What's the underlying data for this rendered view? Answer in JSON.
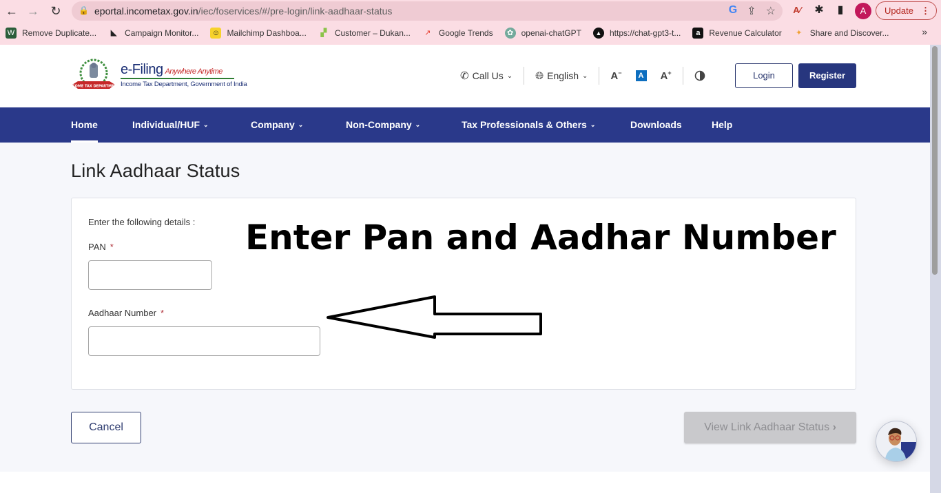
{
  "browser": {
    "url_host": "eportal.incometax.gov.in",
    "url_path": "/iec/foservices/#/pre-login/link-aadhaar-status",
    "profile_initial": "A",
    "update_label": "Update",
    "bookmarks": [
      {
        "label": "Remove Duplicate...",
        "icon": "remove-duplicate-icon"
      },
      {
        "label": "Campaign Monitor...",
        "icon": "campaign-monitor-icon"
      },
      {
        "label": "Mailchimp Dashboa...",
        "icon": "mailchimp-icon"
      },
      {
        "label": "Customer – Dukan...",
        "icon": "dukan-icon"
      },
      {
        "label": "Google Trends",
        "icon": "google-trends-icon"
      },
      {
        "label": "openai-chatGPT",
        "icon": "openai-icon"
      },
      {
        "label": "https://chat-gpt3-t...",
        "icon": "chat-gpt3-icon"
      },
      {
        "label": "Revenue Calculator",
        "icon": "amazon-icon"
      },
      {
        "label": "Share and Discover...",
        "icon": "share-discover-icon"
      }
    ],
    "more_bookmarks": "»"
  },
  "header": {
    "logo_title": "e-Filing",
    "logo_tagline": "Anywhere Anytime",
    "logo_subtitle": "Income Tax Department, Government of India",
    "call_us": "Call Us",
    "language": "English",
    "font_decrease": "A",
    "font_normal": "A",
    "font_increase": "A",
    "login_label": "Login",
    "register_label": "Register"
  },
  "nav": {
    "items": [
      {
        "label": "Home",
        "active": true,
        "dropdown": false
      },
      {
        "label": "Individual/HUF",
        "dropdown": true
      },
      {
        "label": "Company",
        "dropdown": true
      },
      {
        "label": "Non-Company",
        "dropdown": true
      },
      {
        "label": "Tax Professionals & Others",
        "dropdown": true
      },
      {
        "label": "Downloads",
        "dropdown": false
      },
      {
        "label": "Help",
        "dropdown": false
      }
    ]
  },
  "main": {
    "page_title": "Link Aadhaar Status",
    "form_intro": "Enter the following details :",
    "pan_label": "PAN",
    "pan_value": "",
    "aadhaar_label": "Aadhaar Number",
    "aadhaar_value": "",
    "required_mark": "*",
    "annotation_text": "Enter Pan and Aadhar Number",
    "cancel_label": "Cancel",
    "view_label": "View Link Aadhaar Status",
    "view_chevron": "›"
  },
  "colors": {
    "nav_bg": "#2a398a",
    "register_bg": "#27367e",
    "required": "#b0323a",
    "disabled_btn": "#c9c9cc"
  }
}
